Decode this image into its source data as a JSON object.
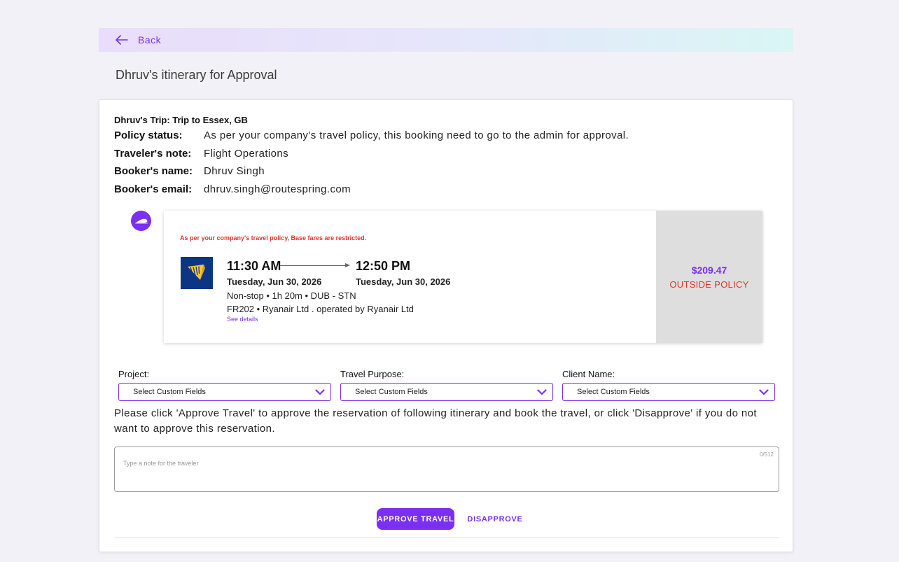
{
  "nav": {
    "back_label": "Back"
  },
  "page": {
    "title": "Dhruv's itinerary for Approval"
  },
  "trip": {
    "title": "Dhruv's Trip: Trip to Essex, GB",
    "policy_status_label": "Policy status:",
    "policy_status_value": "As per your company’s travel policy, this booking need to go to the admin for approval.",
    "traveler_note_label": "Traveler's note:",
    "traveler_note_value": "Flight Operations",
    "booker_name_label": "Booker's name:",
    "booker_name_value": "Dhruv Singh",
    "booker_email_label": "Booker's email:",
    "booker_email_value": "dhruv.singh@routespring.com"
  },
  "flight": {
    "policy_warning": "As per your company's travel policy, Base fares are restricted.",
    "airline_logo_icon": "ryanair-harp-logo",
    "depart_time": "11:30 AM",
    "depart_date": "Tuesday, Jun 30, 2026",
    "arrive_time": "12:50 PM",
    "arrive_date": "Tuesday, Jun 30, 2026",
    "route_info": "Non-stop • 1h 20m • DUB - STN",
    "carrier_info": "FR202 • Ryanair Ltd . operated by Ryanair Ltd",
    "see_details": "See details",
    "price": "$209.47",
    "policy_flag": "OUTSIDE POLICY"
  },
  "custom_fields": [
    {
      "label": "Project:",
      "value": "Select Custom Fields"
    },
    {
      "label": "Travel Purpose:",
      "value": "Select Custom Fields"
    },
    {
      "label": "Client Name:",
      "value": "Select Custom Fields"
    }
  ],
  "instructions": "Please click 'Approve Travel' to approve the reservation of following itinerary and book the travel, or click 'Disapprove' if you do not want to approve this reservation.",
  "note": {
    "placeholder": "Type a note for the traveler",
    "counter": "0/512"
  },
  "actions": {
    "approve_label": "APPROVE TRAVEL",
    "disapprove_label": "DISAPPROVE"
  },
  "colors": {
    "accent": "#7b2ff2",
    "warning": "#e0342a",
    "price_panel": "#dedede"
  }
}
